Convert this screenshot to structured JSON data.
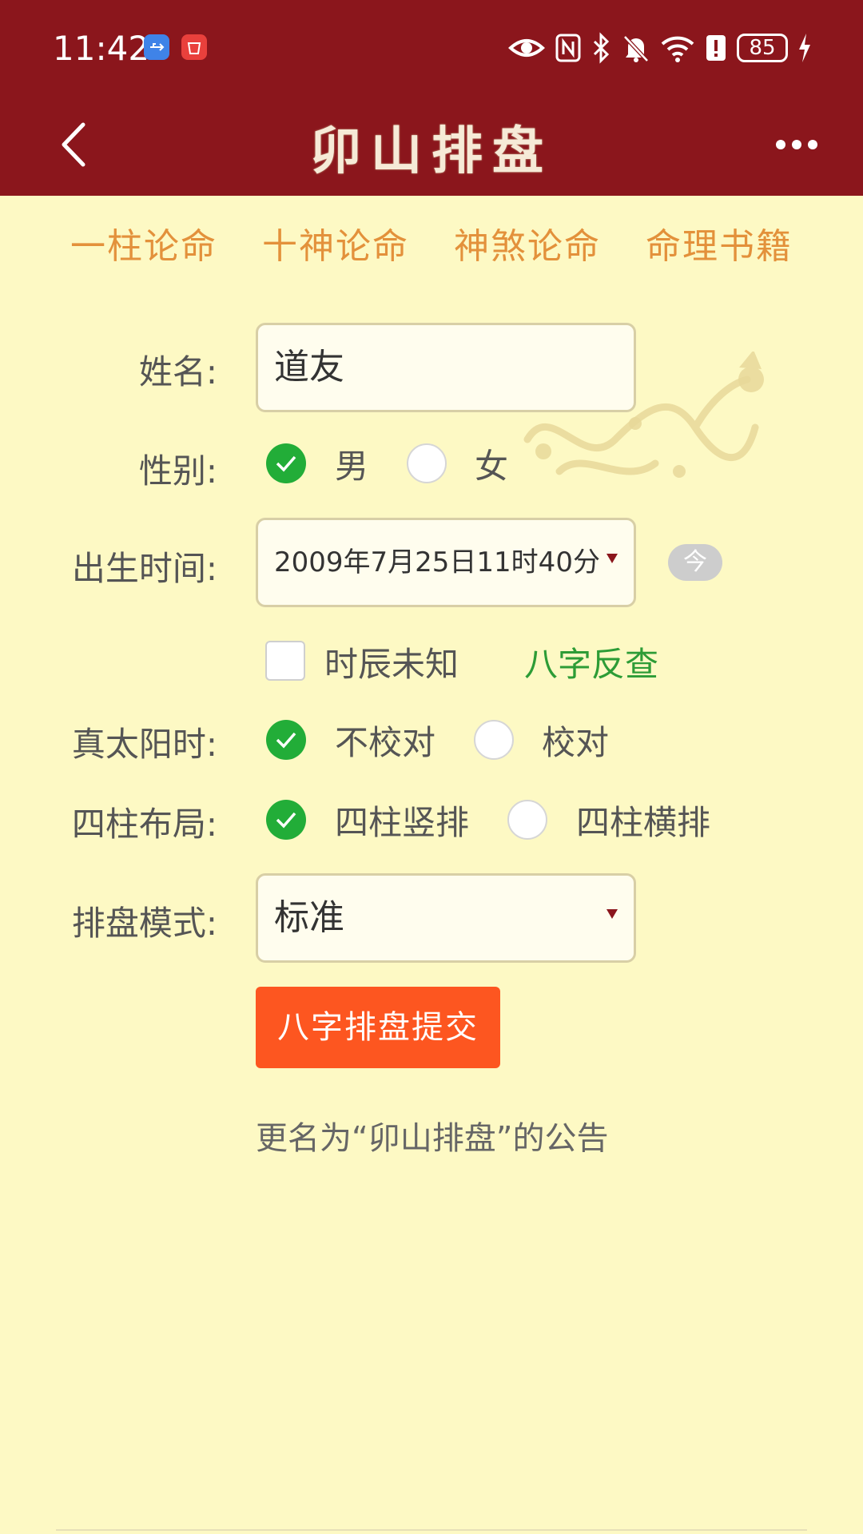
{
  "status_bar": {
    "time": "11:42",
    "battery": "85",
    "notification_icons": [
      "usb-icon",
      "huawei-app-icon"
    ],
    "system_icons": [
      "eye-icon",
      "nfc-icon",
      "bluetooth-icon",
      "mute-icon",
      "wifi-icon",
      "alert-icon",
      "battery-icon",
      "charging-icon"
    ]
  },
  "header": {
    "title": "卯山排盘",
    "back_icon": "chevron-left-icon",
    "menu_icon": "more-dots-icon"
  },
  "nav": {
    "items": [
      "一柱论命",
      "十神论命",
      "神煞论命",
      "命理书籍"
    ]
  },
  "form": {
    "name": {
      "label": "姓名:",
      "value": "道友"
    },
    "gender": {
      "label": "性别:",
      "options": [
        "男",
        "女"
      ],
      "selected": "男"
    },
    "birth": {
      "label": "出生时间:",
      "value": "2009年7月25日11时40分",
      "today_button": "今"
    },
    "unknown_hour": {
      "label": "时辰未知",
      "checked": false
    },
    "reverse_lookup": "八字反查",
    "solar_time": {
      "label": "真太阳时:",
      "options": [
        "不校对",
        "校对"
      ],
      "selected": "不校对"
    },
    "layout": {
      "label": "四柱布局:",
      "options": [
        "四柱竖排",
        "四柱横排"
      ],
      "selected": "四柱竖排"
    },
    "mode": {
      "label": "排盘模式:",
      "value": "标准"
    },
    "submit": "八字排盘提交"
  },
  "notice": "更名为“卯山排盘”的公告",
  "colors": {
    "header_bg": "#8b161c",
    "page_bg": "#fdf9c4",
    "nav_text": "#e3913b",
    "radio_selected": "#22ad38",
    "link": "#2d9c36",
    "submit_bg": "#fd5620"
  }
}
